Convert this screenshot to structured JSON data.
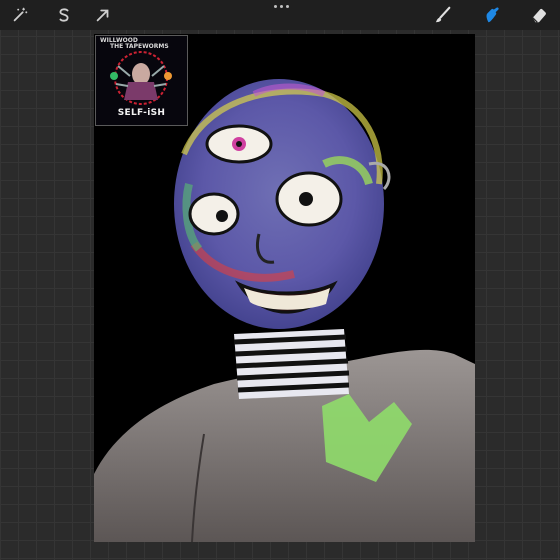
{
  "toolbar": {
    "left_tools": [
      {
        "name": "adjustments",
        "icon": "magic-wand-icon"
      },
      {
        "name": "selection",
        "icon": "selection-s-icon"
      },
      {
        "name": "transform",
        "icon": "arrow-cursor-icon"
      }
    ],
    "right_tools": [
      {
        "name": "brush",
        "icon": "brush-icon"
      },
      {
        "name": "smudge",
        "icon": "smudge-finger-icon",
        "active": true
      },
      {
        "name": "eraser",
        "icon": "eraser-icon"
      }
    ],
    "more_menu_icon": "more-dots-icon",
    "active_color": "#1e88e5"
  },
  "reference": {
    "artist_line1": "WILLWOOD",
    "artist_line2": "THE TAPEWORMS",
    "album_title": "SELF-iSH"
  },
  "colors": {
    "background": "#2b2b2b",
    "canvas": "#000000",
    "heart_green": "#8fdc6a",
    "skin_gray": "#8a8482"
  }
}
